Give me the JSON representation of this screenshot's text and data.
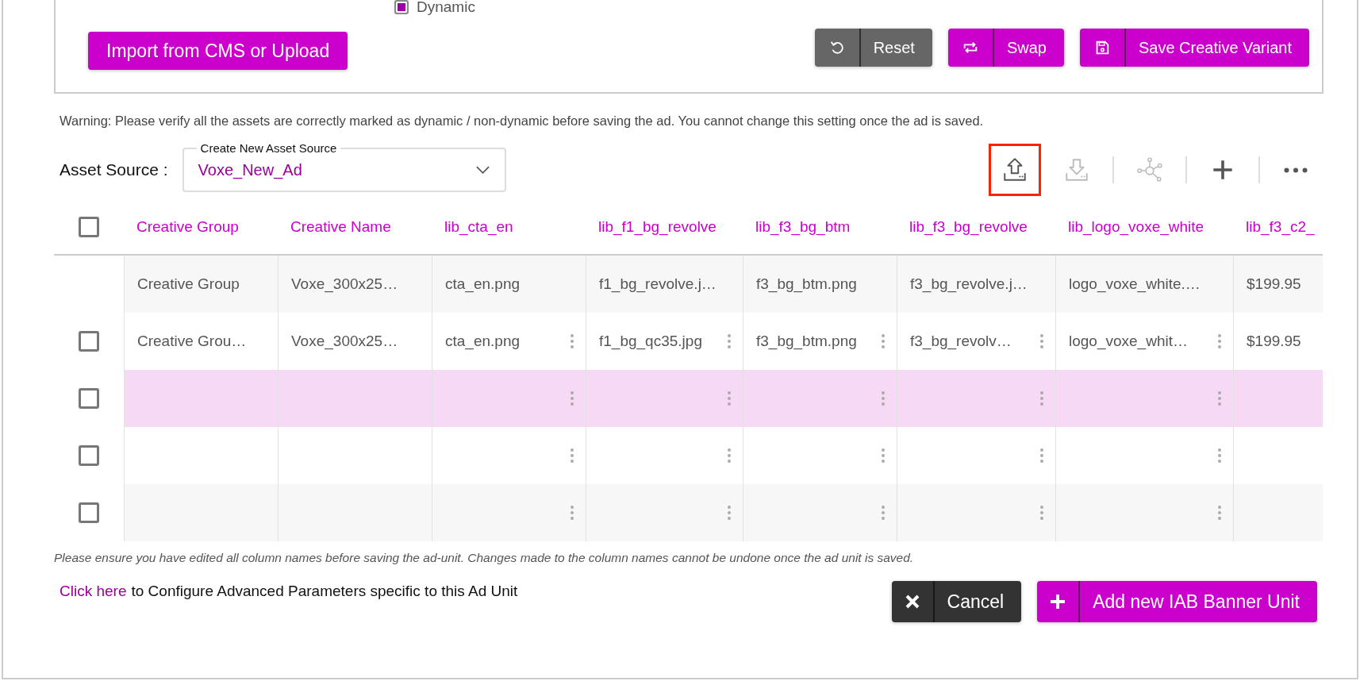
{
  "panel": {
    "dynamic": {
      "label": "Dynamic",
      "checked": true
    },
    "import_button": "Import from CMS or Upload",
    "actions": [
      {
        "kind": "reset",
        "label": "Reset"
      },
      {
        "kind": "swap",
        "label": "Swap"
      },
      {
        "kind": "save",
        "label": "Save Creative Variant"
      }
    ]
  },
  "warning": "Warning: Please verify all the assets are correctly marked as dynamic / non-dynamic before saving the ad. You cannot change this setting once the ad is saved.",
  "asset_source": {
    "label": "Asset Source :",
    "field_label": "Create New Asset Source",
    "value": "Voxe_New_Ad"
  },
  "toolbar": [
    {
      "kind": "upload",
      "disabled": false,
      "outlined": true
    },
    {
      "kind": "download",
      "disabled": true,
      "outlined": false
    },
    {
      "kind": "network",
      "disabled": true,
      "outlined": false
    },
    {
      "kind": "add",
      "disabled": false,
      "outlined": false
    },
    {
      "kind": "more",
      "disabled": false,
      "outlined": false
    }
  ],
  "table": {
    "select_all": {
      "checked": false
    },
    "columns": [
      {
        "label": "Creative Group",
        "menu": false
      },
      {
        "label": "Creative Name",
        "menu": false
      },
      {
        "label": "lib_cta_en",
        "menu": true
      },
      {
        "label": "lib_f1_bg_revolve",
        "menu": true
      },
      {
        "label": "lib_f3_bg_btm",
        "menu": true
      },
      {
        "label": "lib_f3_bg_revolve",
        "menu": true
      },
      {
        "label": "lib_logo_voxe_white",
        "menu": true
      },
      {
        "label": "lib_f3_c2_",
        "menu": false
      }
    ],
    "rows": [
      {
        "kind": "template",
        "hovered": false,
        "cells": [
          "Creative Group",
          "Voxe_300x25…",
          "cta_en.png",
          "f1_bg_revolve.j…",
          "f3_bg_btm.png",
          "f3_bg_revolve.j…",
          "logo_voxe_white.…",
          "$199.95"
        ]
      },
      {
        "kind": "data",
        "checked": false,
        "hovered": false,
        "cells": [
          "Creative Grou…",
          "Voxe_300x25…",
          "cta_en.png",
          "f1_bg_qc35.jpg",
          "f3_bg_btm.png",
          "f3_bg_revolv…",
          "logo_voxe_whit…",
          "$199.95"
        ]
      },
      {
        "kind": "data",
        "checked": false,
        "hovered": true
      },
      {
        "kind": "data",
        "checked": false,
        "hovered": false
      },
      {
        "kind": "data",
        "checked": false,
        "hovered": false
      }
    ]
  },
  "note": "Please ensure you have edited all column names before saving the ad-unit. Changes made to the column names cannot be undone once the ad unit is saved.",
  "advanced": {
    "link": "Click here",
    "text": "to Configure Advanced Parameters specific to this Ad Unit"
  },
  "footer_actions": [
    {
      "kind": "cancel",
      "label": "Cancel"
    },
    {
      "kind": "add",
      "label": "Add new IAB Banner Unit"
    }
  ]
}
